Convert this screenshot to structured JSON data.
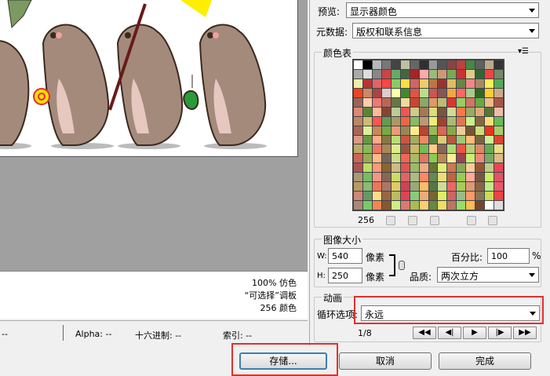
{
  "preview_info": {
    "line1": "100% 仿色",
    "line2": "“可选择”调板",
    "line3": "256 颜色"
  },
  "status_bar": {
    "item0": "--",
    "alpha": "Alpha: --",
    "hex": "十六进制: --",
    "index": "索引: --"
  },
  "settings": {
    "preview_label": "预览:",
    "preview_value": "显示器颜色",
    "metadata_label": "元数据:",
    "metadata_value": "版权和联系信息"
  },
  "color_table": {
    "title": "颜色表",
    "count": "256",
    "colors": [
      "#ffffff",
      "#000000",
      "#b8b8b8",
      "#777777",
      "#444444",
      "#c0c0a0",
      "#666666",
      "#303030",
      "#999999",
      "#555555",
      "#884444",
      "#c04040",
      "#448844",
      "#606060",
      "#bbaa88",
      "#333333",
      "#aaaaaa",
      "#dddddd",
      "#888888",
      "#cc4444",
      "#66aa66",
      "#446644",
      "#aa2222",
      "#ffaaaa",
      "#99bb77",
      "#cc9977",
      "#77aa55",
      "#cc3333",
      "#ddcc88",
      "#336633",
      "#ee4444",
      "#778866",
      "#eeeeaa",
      "#bb3333",
      "#dd6666",
      "#ff4444",
      "#88cc66",
      "#ffdd44",
      "#cc6666",
      "#eecc66",
      "#bb7744",
      "#993333",
      "#ddbb66",
      "#668844",
      "#ee8888",
      "#aa8866",
      "#ffee55",
      "#55aa55",
      "#ee4422",
      "#cc8866",
      "#aa4444",
      "#ddcccc",
      "#ffffaa",
      "#448833",
      "#dd5544",
      "#bbdd88",
      "#cc5555",
      "#885555",
      "#eeaa44",
      "#ff6666",
      "#aacc88",
      "#336622",
      "#ffcc33",
      "#ccaa88",
      "#996655",
      "#ffccaa",
      "#ee7777",
      "#bb6655",
      "#667744",
      "#eedd99",
      "#cc4433",
      "#88aa66",
      "#dd9966",
      "#bbbb77",
      "#dd3333",
      "#99cc66",
      "#cc7766",
      "#66aa44",
      "#eebb88",
      "#aa5544",
      "#dd8877",
      "#558833",
      "#ffbb99",
      "#884433",
      "#bbcc99",
      "#ee5555",
      "#cccc88",
      "#aa7755",
      "#dddd77",
      "#775544",
      "#ccdd99",
      "#ff7744",
      "#99aa66",
      "#ddaa77",
      "#557733",
      "#eebbaa",
      "#bb8866",
      "#ccbb77",
      "#ff5555",
      "#669955",
      "#aa9966",
      "#ee6644",
      "#88bb66",
      "#bb9977",
      "#eeee77",
      "#994433",
      "#aabb77",
      "#dd7755",
      "#ccee88",
      "#886644",
      "#ffdd77",
      "#66bb55",
      "#aa6655",
      "#ddee99",
      "#cc8855",
      "#77aa44",
      "#ee9977",
      "#998855",
      "#ffee88",
      "#bb4433",
      "#99bb55",
      "#dd6655",
      "#88aa44",
      "#eecc99",
      "#775533",
      "#ccdd77",
      "#ee3322",
      "#aacc66",
      "#dd9988",
      "#669944",
      "#ffaa88",
      "#887744",
      "#bbdd77",
      "#cc5544",
      "#aaaa66",
      "#ee8866",
      "#558844",
      "#ddcc77",
      "#bb5544",
      "#99cc77",
      "#ffbb77",
      "#776644",
      "#ccee99",
      "#dd4433",
      "#bbaa66",
      "#88bb55",
      "#ee7766",
      "#aa8855",
      "#ddee88",
      "#995544",
      "#ccbb66",
      "#77bb55",
      "#ffcc88",
      "#886655",
      "#aadd77",
      "#ee5544",
      "#bbcc77",
      "#dd8866",
      "#66aa55",
      "#eedd88",
      "#cc6655",
      "#99aa55",
      "#ffbb88",
      "#776655",
      "#ccdd88",
      "#ee6655",
      "#aabb66",
      "#dd7766",
      "#88cc55",
      "#bb8855",
      "#ffee99",
      "#994455",
      "#ccee77",
      "#ee8877",
      "#77aa66",
      "#ddbb88",
      "#aa5555",
      "#bbdd66",
      "#ff9977",
      "#886633",
      "#ccbb88",
      "#dd5555",
      "#99bb66",
      "#eeaa88",
      "#667733",
      "#ddee77",
      "#cc7755",
      "#88aa55",
      "#ffcc99",
      "#995533",
      "#bbcc88",
      "#ee4455",
      "#aa9977",
      "#77bb66",
      "#ee9988",
      "#886655",
      "#ccdd66",
      "#dd6666",
      "#aabb88",
      "#ff8866",
      "#668855",
      "#eedd77",
      "#bb6644",
      "#99cc55",
      "#ffaa99",
      "#775544",
      "#ccee66",
      "#dd5566",
      "#bb9966",
      "#88bb77",
      "#ee7755",
      "#aa7766",
      "#ddcc66",
      "#cc4455",
      "#99aa77",
      "#ffbb66",
      "#557744",
      "#ccdd99",
      "#ee6666",
      "#aacc55",
      "#dd9977",
      "#886644",
      "#bbee88",
      "#ee5566",
      "#cc8877",
      "#669966",
      "#ffdd88",
      "#996644",
      "#bbbb66",
      "#dd4455",
      "#88cc77",
      "#eeaa77",
      "#776633",
      "#ddee66",
      "#cc6666",
      "#99bb88",
      "#ff9966",
      "#887755",
      "#ccdd55",
      "#ee4444",
      "#aa8877",
      "#77cc66",
      "#ee8855",
      "#885533",
      "#ccee88",
      "#dd7777",
      "#aabb55",
      "#ffcc77",
      "#668844",
      "#eedd66",
      "#bb7766",
      "#99dd66",
      "#ffbb55",
      "#774433",
      "#ffffff",
      "#dddddd"
    ]
  },
  "image_size": {
    "title": "图像大小",
    "w_label": "W:",
    "w_value": "540",
    "w_unit": "像素",
    "h_label": "H:",
    "h_value": "250",
    "h_unit": "像素",
    "percent_label": "百分比:",
    "percent_value": "100",
    "percent_unit": "%",
    "quality_label": "品质:",
    "quality_value": "两次立方"
  },
  "animation": {
    "title": "动画",
    "loop_label": "循环选项:",
    "loop_value": "永远",
    "frame_counter": "1/8"
  },
  "buttons": {
    "save": "存储...",
    "cancel": "取消",
    "done": "完成"
  },
  "colors": {
    "bear_body": "#a48a7b",
    "bear_belly": "#e6c8c0",
    "highlight_red": "#e03030"
  }
}
